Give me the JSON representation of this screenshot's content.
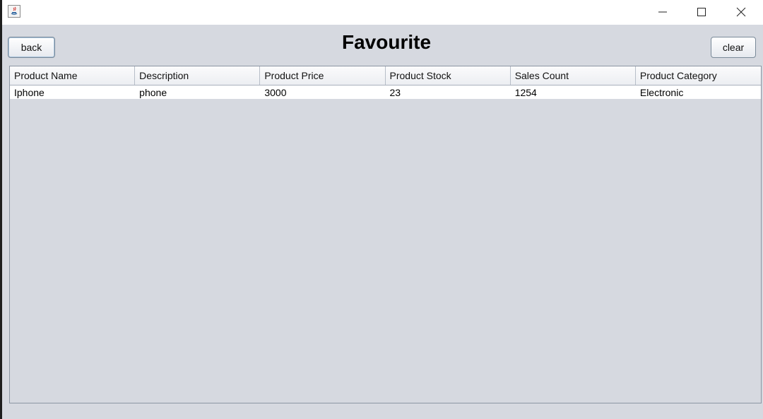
{
  "window": {
    "title_icon": "java-icon",
    "controls": [
      "minimize-icon",
      "maximize-icon",
      "close-icon"
    ]
  },
  "toolbar": {
    "back_label": "back",
    "title": "Favourite",
    "clear_label": "clear"
  },
  "table": {
    "columns": [
      "Product Name",
      "Description",
      "Product Price",
      "Product Stock",
      "Sales Count",
      "Product Category"
    ],
    "rows": [
      [
        "Iphone",
        "phone",
        "3000",
        "23",
        "1254",
        "Electronic"
      ]
    ]
  }
}
